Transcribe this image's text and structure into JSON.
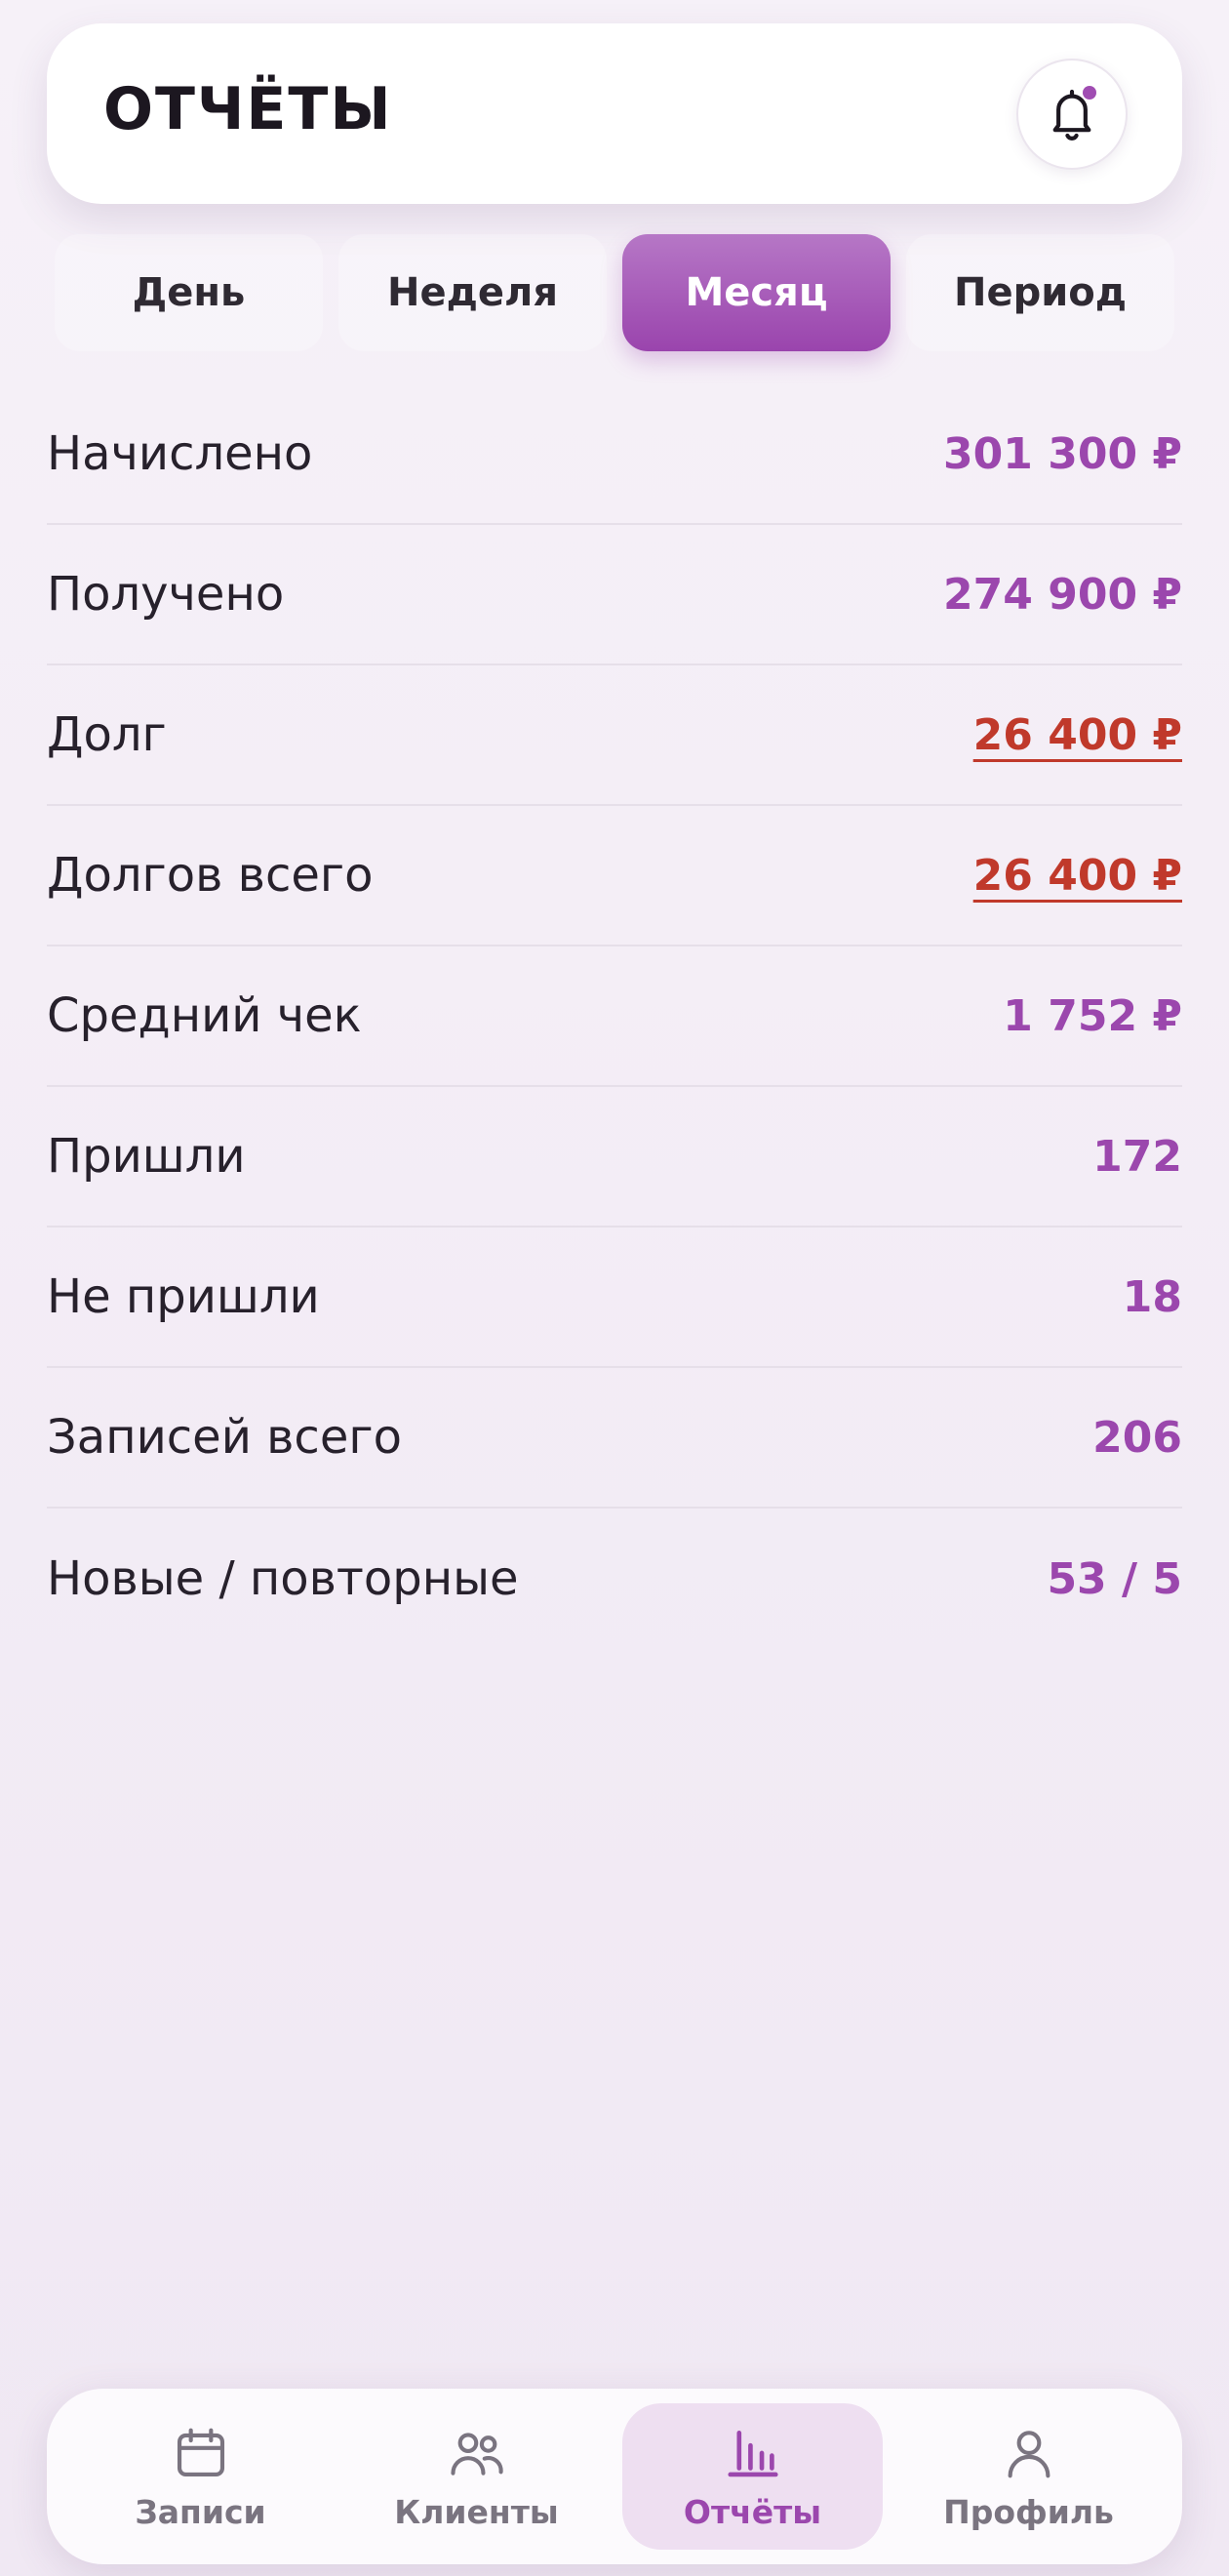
{
  "header": {
    "title": "ОТЧЁТЫ"
  },
  "tabs": [
    {
      "label": "День",
      "active": false
    },
    {
      "label": "Неделя",
      "active": false
    },
    {
      "label": "Месяц",
      "active": true
    },
    {
      "label": "Период",
      "active": false
    }
  ],
  "stats": [
    {
      "label": "Начислено",
      "value": "301 300 ₽"
    },
    {
      "label": "Получено",
      "value": "274 900 ₽"
    },
    {
      "label": "Долг",
      "value": "26 400 ₽"
    },
    {
      "label": "Долгов всего",
      "value": "26 400 ₽"
    },
    {
      "label": "Средний чек",
      "value": "1 752 ₽"
    },
    {
      "label": "Пришли",
      "value": "172"
    },
    {
      "label": "Не пришли",
      "value": "18"
    },
    {
      "label": "Записей всего",
      "value": "206"
    },
    {
      "label": "Новые / повторные",
      "value": "53 / 5"
    }
  ],
  "nav": [
    {
      "label": "Записи",
      "icon": "calendar-icon",
      "active": false
    },
    {
      "label": "Клиенты",
      "icon": "people-icon",
      "active": false
    },
    {
      "label": "Отчёты",
      "icon": "bar-chart-icon",
      "active": true
    },
    {
      "label": "Профиль",
      "icon": "person-icon",
      "active": false
    }
  ],
  "colors": {
    "accent": "#9b47ad",
    "debt": "#c0392b",
    "background": "#f1ebf4"
  }
}
